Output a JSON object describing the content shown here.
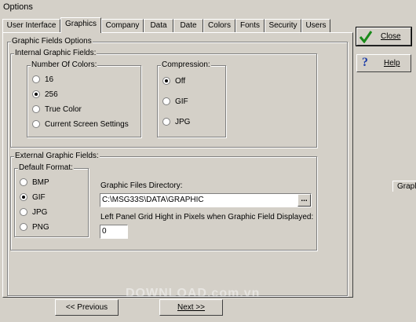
{
  "window": {
    "title": "Options"
  },
  "tabs": [
    {
      "label": "User Interface"
    },
    {
      "label": "Graphics"
    },
    {
      "label": "Company"
    },
    {
      "label": "Data"
    },
    {
      "label": "Date"
    },
    {
      "label": "Colors"
    },
    {
      "label": "Fonts"
    },
    {
      "label": "Security"
    },
    {
      "label": "Users"
    }
  ],
  "active_tab": "Graphics",
  "graphic_fields": {
    "label": "Graphic Fields Options",
    "internal": {
      "label": "Internal Graphic Fields:",
      "colors": {
        "label": "Number Of Colors:",
        "options": [
          "16",
          "256",
          "True Color",
          "Current Screen Settings"
        ],
        "selected": "256"
      },
      "compression": {
        "label": "Compression:",
        "options": [
          "Off",
          "GIF",
          "JPG"
        ],
        "selected": "Off"
      }
    },
    "external": {
      "label": "External Graphic Fields:",
      "format": {
        "label": "Default Format:",
        "options": [
          "BMP",
          "GIF",
          "JPG",
          "PNG"
        ],
        "selected": "GIF"
      },
      "directory": {
        "label": "Graphic Files Directory:",
        "value": "C:\\MSG33S\\DATA\\GRAPHIC",
        "browse_label": "..."
      },
      "grid_height": {
        "label": "Left Panel Grid Hight in Pixels when Graphic Field Displayed:",
        "value": "0"
      }
    }
  },
  "side_buttons": {
    "close": {
      "label": "Close",
      "icon": "checkmark-icon"
    },
    "help": {
      "label": "Help",
      "icon": "question-icon"
    }
  },
  "side_stub": {
    "label": "Grapl"
  },
  "nav": {
    "previous": "<< Previous",
    "next": "Next >>"
  },
  "watermark": "DOWNLOAD.com.vn",
  "colors": {
    "face": "#d4d0c8",
    "check_green": "#1a8a1a",
    "help_blue": "#1f3fa8"
  }
}
